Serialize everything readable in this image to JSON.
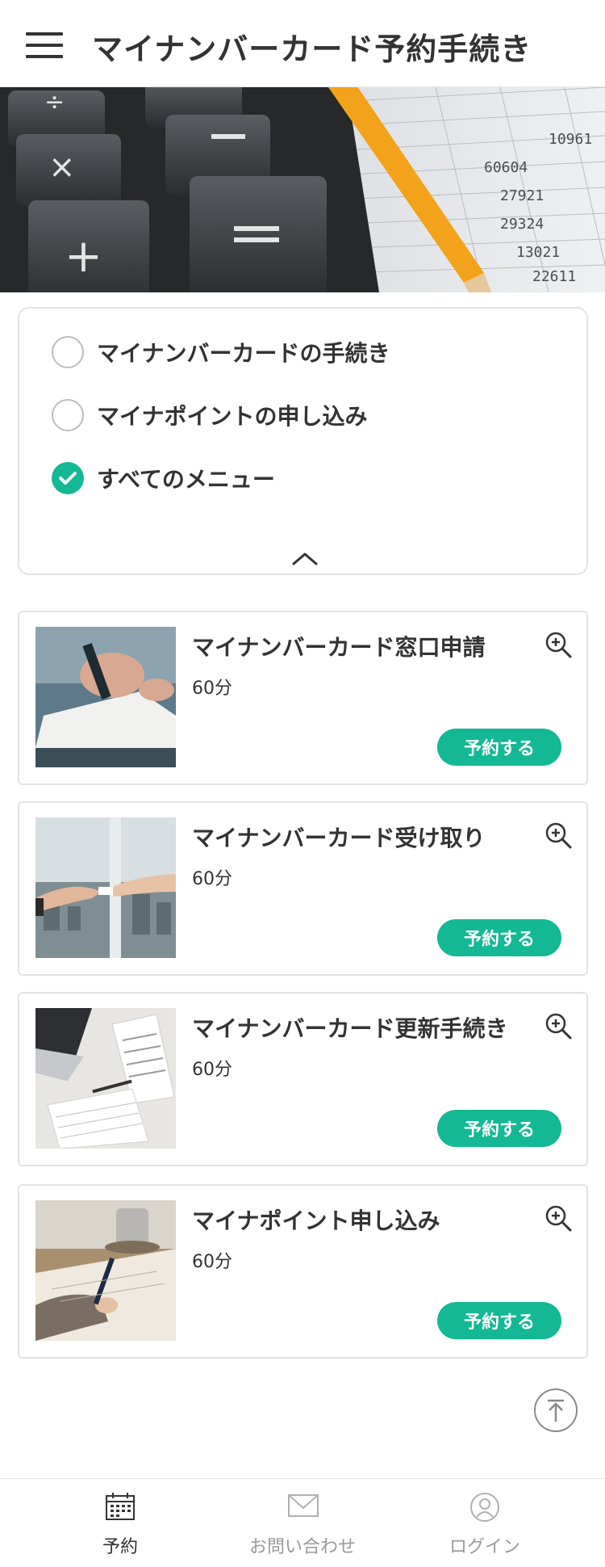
{
  "header": {
    "title": "マイナンバーカード予約手続き"
  },
  "filter": {
    "options": [
      {
        "label": "マイナンバーカードの手続き",
        "checked": false
      },
      {
        "label": "マイナポイントの申し込み",
        "checked": false
      },
      {
        "label": "すべてのメニュー",
        "checked": true
      }
    ]
  },
  "menu": {
    "items": [
      {
        "title": "マイナンバーカード窓口申請",
        "duration": "60分",
        "button": "予約する"
      },
      {
        "title": "マイナンバーカード受け取り",
        "duration": "60分",
        "button": "予約する"
      },
      {
        "title": "マイナンバーカード更新手続き",
        "duration": "60分",
        "button": "予約する"
      },
      {
        "title": "マイナポイント申し込み",
        "duration": "60分",
        "button": "予約する"
      }
    ]
  },
  "tabbar": {
    "items": [
      {
        "label": "予約",
        "icon": "calendar-icon",
        "active": true
      },
      {
        "label": "お問い合わせ",
        "icon": "mail-icon",
        "active": false
      },
      {
        "label": "ログイン",
        "icon": "user-icon",
        "active": false
      }
    ]
  },
  "colors": {
    "accent": "#14b894",
    "text": "#333333",
    "muted": "#9a9a9a",
    "border": "#e2e2e2"
  }
}
